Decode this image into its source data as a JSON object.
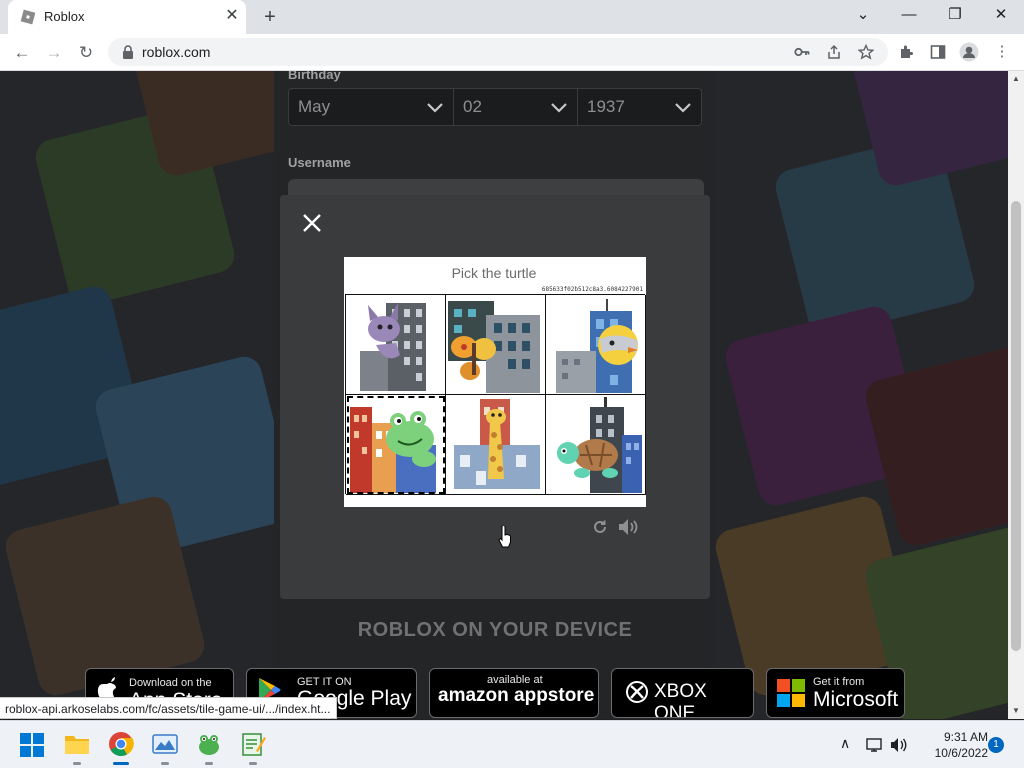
{
  "browser": {
    "tab_title": "Roblox",
    "tab_close": "✕",
    "new_tab": "+",
    "url": "roblox.com",
    "window_controls": {
      "minimize": "—",
      "restore": "❐",
      "close": "✕",
      "tab_search": "⌄"
    },
    "status_url": "roblox-api.arkoselabs.com/fc/assets/tile-game-ui/.../index.ht..."
  },
  "signup": {
    "birthday_label": "Birthday",
    "birth_month": "May",
    "birth_day": "02",
    "birth_year": "1937",
    "username_label": "Username"
  },
  "captcha": {
    "prompt": "Pick the turtle",
    "hash": "685633f02b512c8a3.6084227901",
    "tiles": [
      {
        "animal": "bat",
        "selected": false
      },
      {
        "animal": "butterfly",
        "selected": false
      },
      {
        "animal": "chick",
        "selected": false
      },
      {
        "animal": "frog",
        "selected": true
      },
      {
        "animal": "giraffe",
        "selected": false
      },
      {
        "animal": "turtle",
        "selected": false
      }
    ]
  },
  "device_section": {
    "heading": "ROBLOX ON YOUR DEVICE",
    "stores": [
      {
        "small": "Download on the",
        "big": "App Store"
      },
      {
        "small": "GET IT ON",
        "big": "Google Play"
      },
      {
        "small": "available at",
        "big": "amazon appstore"
      },
      {
        "small": "",
        "big": "XBOX ONE"
      },
      {
        "small": "Get it from",
        "big": "Microsoft"
      }
    ]
  },
  "taskbar": {
    "time": "9:31 AM",
    "date": "10/6/2022",
    "notifications": "1",
    "chevron": "∧"
  },
  "colors": {
    "page_dark": "#232527",
    "modal": "#393b3d",
    "windows_accent": "#0067c0"
  }
}
